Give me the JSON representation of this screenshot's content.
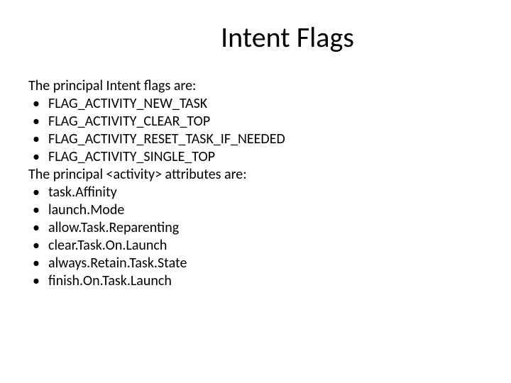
{
  "title": "Intent Flags",
  "intro1": "The principal Intent flags are:",
  "flags": [
    "FLAG_ACTIVITY_NEW_TASK",
    "FLAG_ACTIVITY_CLEAR_TOP",
    "FLAG_ACTIVITY_RESET_TASK_IF_NEEDED",
    "FLAG_ACTIVITY_SINGLE_TOP"
  ],
  "intro2": "The principal <activity> attributes are:",
  "attributes": [
    "task.Affinity",
    "launch.Mode",
    "allow.Task.Reparenting",
    "clear.Task.On.Launch",
    "always.Retain.Task.State",
    "finish.On.Task.Launch"
  ]
}
